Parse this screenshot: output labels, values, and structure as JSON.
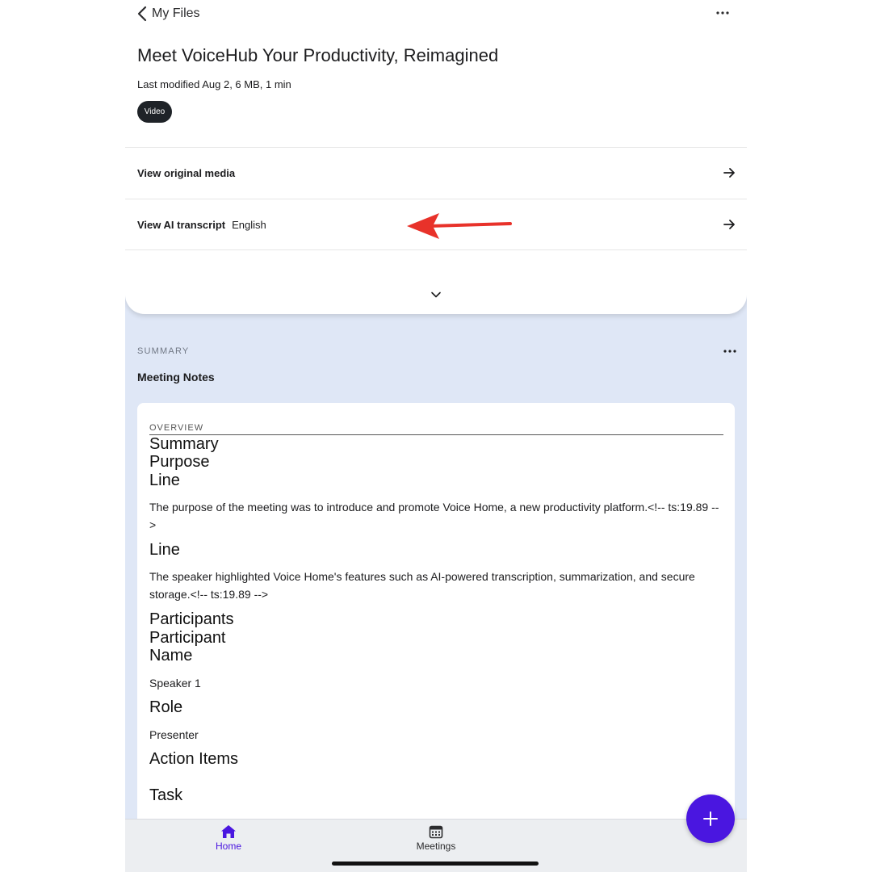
{
  "header": {
    "back_label": "My Files",
    "title": "Meet VoiceHub Your Productivity, Reimagined",
    "meta": "Last modified Aug 2, 6 MB, 1 min",
    "chip": "Video"
  },
  "rows": {
    "original_media": "View original media",
    "ai_transcript": "View AI transcript",
    "ai_transcript_language": "English"
  },
  "summary": {
    "section_label": "SUMMARY",
    "title": "Meeting Notes",
    "overview_label": "OVERVIEW",
    "heading_summary": "Summary",
    "heading_purpose": "Purpose",
    "heading_line_1": "Line",
    "purpose_text": "The purpose of the meeting was to introduce and promote Voice Home, a new productivity platform.<!-- ts:19.89 -->",
    "heading_line_2": "Line",
    "features_text": "The speaker highlighted Voice Home's features such as AI-powered transcription, summarization, and secure storage.<!-- ts:19.89 -->",
    "heading_participants": "Participants",
    "heading_participant": "Participant",
    "heading_name": "Name",
    "participant_name": "Speaker 1",
    "heading_role": "Role",
    "participant_role": "Presenter",
    "heading_action_items": "Action Items",
    "heading_task": "Task"
  },
  "tabbar": {
    "home_label": "Home",
    "meetings_label": "Meetings"
  },
  "colors": {
    "accent": "#4a16e0",
    "annotation_arrow": "#e8322a",
    "summary_background": "#dfe7f6"
  },
  "icons": {
    "back": "chevron-left-icon",
    "more": "more-horizontal-icon",
    "row_arrow": "arrow-right-icon",
    "expand": "chevron-down-icon",
    "home": "home-icon",
    "meetings": "calendar-icon",
    "fab": "plus-icon"
  }
}
